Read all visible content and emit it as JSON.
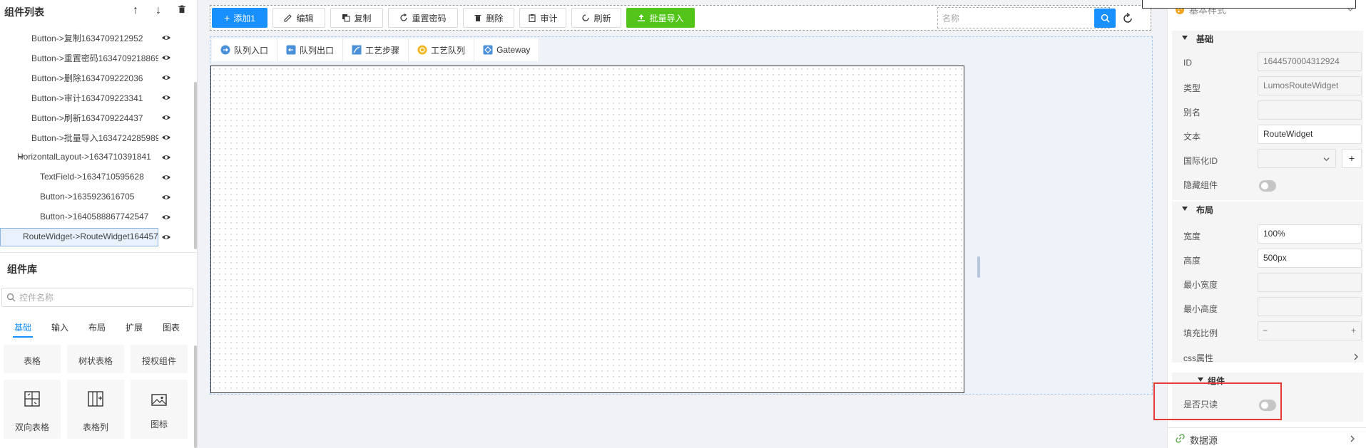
{
  "tree": {
    "title": "组件列表",
    "items": [
      {
        "label": "Button->复制1634709212952",
        "indent": 2
      },
      {
        "label": "Button->重置密码1634709218869",
        "indent": 2
      },
      {
        "label": "Button->删除1634709222036",
        "indent": 2
      },
      {
        "label": "Button->审计1634709223341",
        "indent": 2
      },
      {
        "label": "Button->刷新1634709224437",
        "indent": 2
      },
      {
        "label": "Button->批量导入1634724285989",
        "indent": 2
      },
      {
        "label": "HorizontalLayout->1634710391841",
        "indent": 1
      },
      {
        "label": "TextField->1634710595628",
        "indent": 3
      },
      {
        "label": "Button->1635923616705",
        "indent": 3
      },
      {
        "label": "Button->1640588867742547",
        "indent": 3
      },
      {
        "label": "RouteWidget->RouteWidget164457",
        "indent": 2
      }
    ]
  },
  "library": {
    "title": "组件库",
    "search_placeholder": "控件名称",
    "tabs": [
      "基础",
      "输入",
      "布局",
      "扩展",
      "图表"
    ],
    "cards": [
      "表格",
      "树状表格",
      "授权组件",
      "双向表格",
      "表格列",
      "图标"
    ]
  },
  "toolbar": {
    "buttons": [
      "添加1",
      "编辑",
      "复制",
      "重置密码",
      "删除",
      "审计",
      "刷新",
      "批量导入"
    ],
    "search_placeholder": "名称"
  },
  "route": {
    "tabs": [
      "队列入口",
      "队列出口",
      "工艺步骤",
      "工艺队列",
      "Gateway"
    ]
  },
  "props": {
    "style_header": "基本样式",
    "basic_title": "基础",
    "id_label": "ID",
    "id_value": "1644570004312924",
    "type_label": "类型",
    "type_value": "LumosRouteWidget",
    "alias_label": "别名",
    "text_label": "文本",
    "text_value": "RouteWidget",
    "i18n_label": "国际化ID",
    "hide_label": "隐藏组件",
    "layout_title": "布局",
    "width_label": "宽度",
    "width_value": "100%",
    "height_label": "高度",
    "height_value": "500px",
    "minw_label": "最小宽度",
    "minh_label": "最小高度",
    "fill_label": "填充比例",
    "fill_minus": "−",
    "fill_plus": "+",
    "css_label": "css属性",
    "comp_title": "组件",
    "readonly_label": "是否只读",
    "datasource_label": "数据源",
    "plus_btn": "+"
  },
  "colors": {
    "primary": "#1890ff",
    "success": "#52c41a",
    "highlight": "#e53935"
  }
}
